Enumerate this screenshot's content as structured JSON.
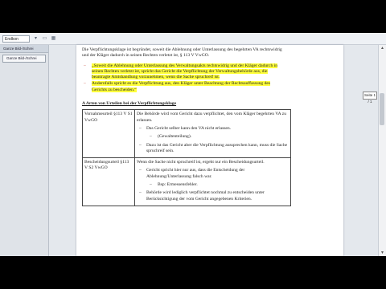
{
  "toolbar": {
    "zoom_value": "Endkon"
  },
  "left_panel": {
    "title": "Ganze Bild-/Schrei",
    "button_label": "Ganze Bild-/Schrei"
  },
  "page_indicator": "Seite 1 / 1",
  "document": {
    "intro": "Die Verpflichtungsklage ist begründet, soweit die Ablehnung oder Unterlassung des begehrten VA rechtswidrig und der Kläger dadurch in seinen Rechten verletzt ist, § 113 V VwGO.",
    "bullets": [
      "„Soweit die Ablehnung oder Unterlassung des Verwaltungsakts rechtswidrig und der Kläger dadurch in seinen Rechten verletzt ist, spricht das Gericht die Verpflichtung der Verwaltungsbehörde aus, die beantragte Amtshandlung vorzunehmen, wenn die Sache spruchreif ist.",
      "Andernfalls spricht es die Verpflichtung aus, den Kläger unter Beachtung der Rechtsauffassung des Gerichts zu bescheiden.“"
    ],
    "section_heading": "A Arten von Urteilen bei der Verpflichtungsklage",
    "table": {
      "rows": [
        {
          "type_label": "Vornahmeurteil §113 V S1 VwGO",
          "intro": "Die Behörde wird vom Gericht dazu verpflichtet, den vom Kläger begehrten VA zu erlassen.",
          "items": [
            "Das Gericht selber kann den VA nicht erlassen.",
            "Dazu ist das Gericht aber die Verpflichtung aussprechen kann, muss die Sache spruchreif sein."
          ],
          "subitem": "(Gewaltenteilung)."
        },
        {
          "type_label": "Bescheidungsurteil §113 V S2 VwGO",
          "intro": "Wenn die Sache nicht spruchreif ist, ergeht nur ein Bescheidungsurteil.",
          "items": [
            "Gericht spricht hier nur aus, dass die Entscheidung der Ablehnung/Unterlassung falsch war.",
            "Behörde wird lediglich verpflichtet nochmal zu entscheiden unter Berücksichtigung der vom Gericht angegebenen Kriterien."
          ],
          "subitem": "Bsp: Ermessensfehler."
        }
      ]
    }
  },
  "colors": {
    "highlight": "#ffff3c",
    "bullet_mark": "#c0392b"
  }
}
